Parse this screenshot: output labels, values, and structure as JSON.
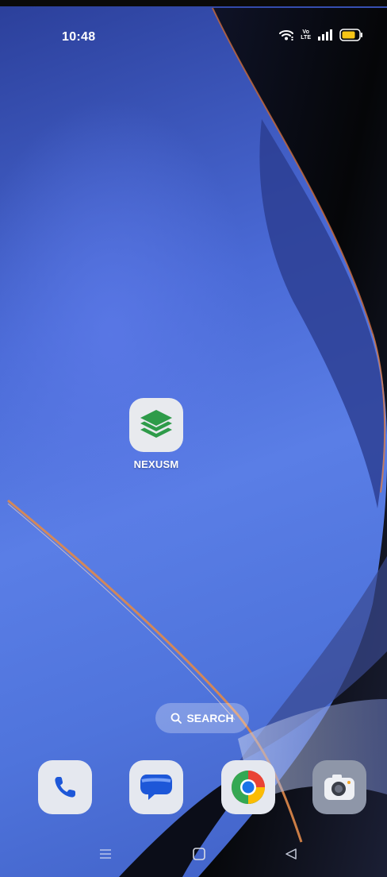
{
  "status_bar": {
    "time": "10:48",
    "icons": [
      "wifi-icon",
      "volte-icon",
      "signal-icon",
      "battery-icon"
    ],
    "volte_top": "Vo",
    "volte_bottom": "LTE"
  },
  "home": {
    "app": {
      "label": "NEXUSM",
      "icon": "layers-icon",
      "tile_color": "#e8eaee",
      "icon_color": "#2e9b49"
    }
  },
  "search": {
    "label": "SEARCH",
    "icon": "search-icon"
  },
  "dock": [
    {
      "name": "phone",
      "icon": "phone-icon"
    },
    {
      "name": "messages",
      "icon": "chat-bubble-icon"
    },
    {
      "name": "chrome",
      "icon": "chrome-icon"
    },
    {
      "name": "camera",
      "icon": "camera-icon"
    }
  ],
  "nav_bar": [
    "menu-icon",
    "home-icon",
    "back-icon"
  ],
  "colors": {
    "battery": "#f6c515",
    "wallpaper_blue": "#4f74dc"
  }
}
